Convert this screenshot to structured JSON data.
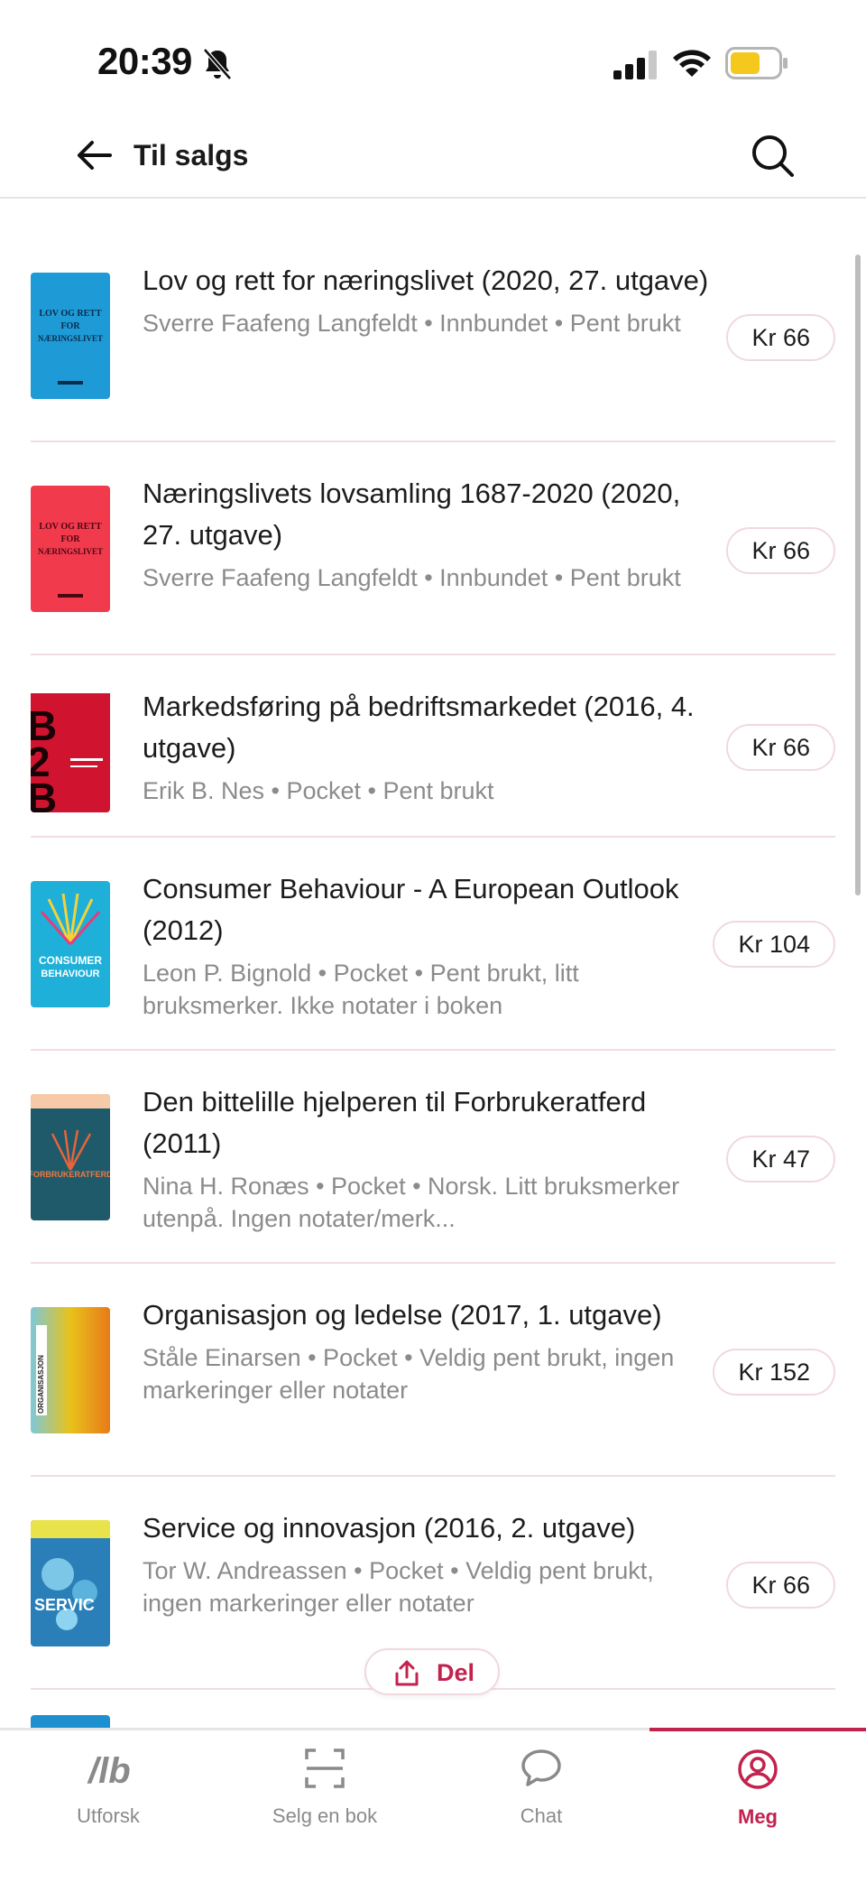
{
  "status_bar": {
    "time": "20:39",
    "icons": [
      "bell-off-icon",
      "signal-icon",
      "wifi-icon",
      "battery-icon"
    ]
  },
  "header": {
    "back_icon": "arrow-left-icon",
    "title": "Til salgs",
    "search_icon": "search-icon"
  },
  "listings": [
    {
      "title": "Lov og rett for næringslivet (2020, 27. utgave)",
      "meta": "Sverre Faafeng Langfeldt • Innbundet • Pent brukt",
      "price": "Kr 66",
      "cover_text": "LOV OG RETT FOR NÆRINGSLIVET",
      "cover_color": "#1e9bd7"
    },
    {
      "title": "Næringslivets lovsamling 1687-2020 (2020, 27. utgave)",
      "meta": "Sverre Faafeng Langfeldt • Innbundet • Pent brukt",
      "price": "Kr 66",
      "cover_text": "LOV OG RETT FOR NÆRINGSLIVET",
      "cover_color": "#f23a4d"
    },
    {
      "title": "Markedsføring på bedriftsmarkedet (2016, 4. utgave)",
      "meta": "Erik B. Nes • Pocket • Pent brukt",
      "price": "Kr 66",
      "cover_text": "B2B",
      "cover_color": "#d0142f"
    },
    {
      "title": "Consumer Behaviour - A European Outlook (2012)",
      "meta": "Leon P. Bignold • Pocket • Pent brukt, litt bruksmerker. Ikke notater i boken",
      "price": "Kr 104",
      "cover_text": "CONSUMER BEHAVIOUR",
      "cover_color": "#1eb0d8"
    },
    {
      "title": "Den bittelille hjelperen til Forbrukeratferd (2011)",
      "meta": "Nina H. Ronæs • Pocket • Norsk. Litt bruksmerker utenpå. Ingen notater/merk...",
      "price": "Kr 47",
      "cover_text": "FORBRUKERATFERD",
      "cover_color": "#1f5a6b"
    },
    {
      "title": "Organisasjon og ledelse (2017, 1. utgave)",
      "meta": "Ståle Einarsen • Pocket • Veldig pent brukt, ingen markeringer eller notater",
      "price": "Kr 152",
      "cover_text": "ORGANISASJON OG LEDELSE",
      "cover_color": "#e8c21a"
    },
    {
      "title": "Service og innovasjon (2016, 2. utgave)",
      "meta": "Tor W. Andreassen • Pocket • Veldig pent brukt, ingen markeringer eller notater",
      "price": "Kr 66",
      "cover_text": "SERVICE OG INNOVASJON",
      "cover_color": "#2a7fb8"
    }
  ],
  "share": {
    "label": "Del",
    "icon": "share-icon"
  },
  "bottom_nav": {
    "items": [
      {
        "label": "Utforsk",
        "icon": "explore-icon",
        "active": false
      },
      {
        "label": "Selg en bok",
        "icon": "scan-icon",
        "active": false
      },
      {
        "label": "Chat",
        "icon": "chat-icon",
        "active": false
      },
      {
        "label": "Meg",
        "icon": "profile-icon",
        "active": true
      }
    ]
  },
  "colors": {
    "accent": "#c2224e",
    "muted_text": "#8b8b8b",
    "divider": "#f1dde1"
  }
}
